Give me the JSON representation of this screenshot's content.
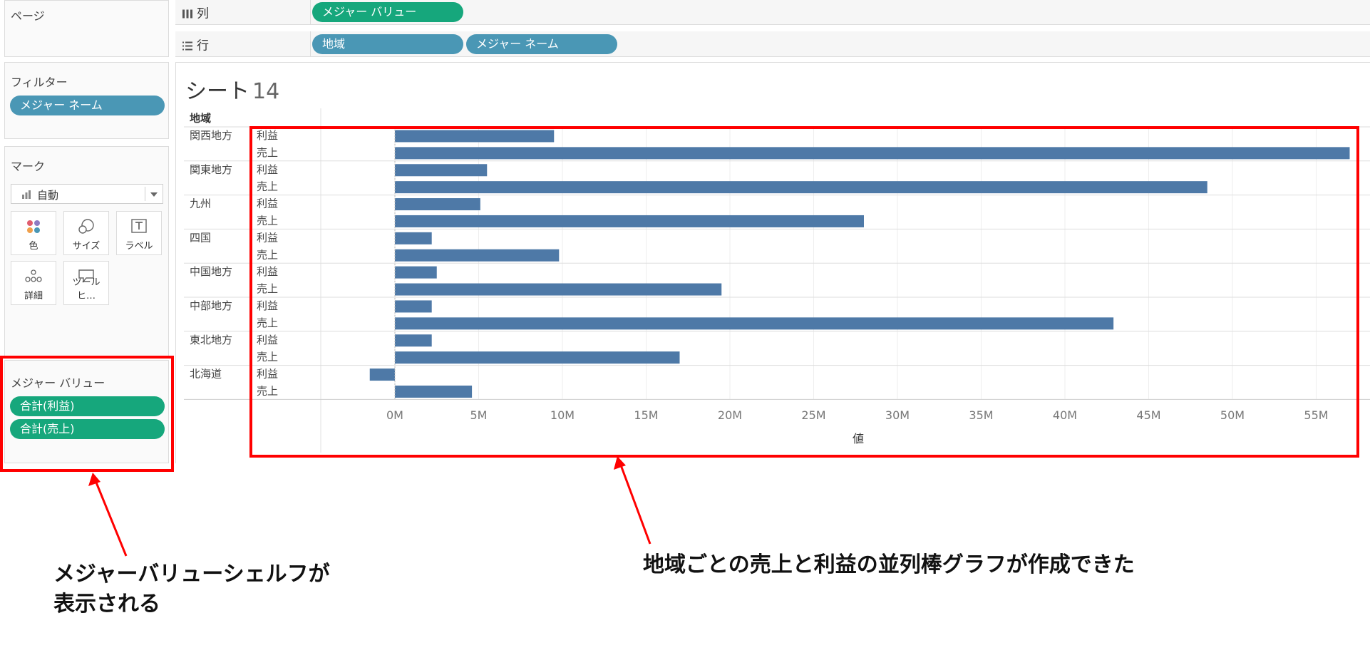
{
  "sidebar": {
    "pages_title": "ページ",
    "filters_title": "フィルター",
    "filter_pill": "メジャー ネーム",
    "marks_title": "マーク",
    "mark_type": "自動",
    "mark_buttons": [
      "色",
      "サイズ",
      "ラベル",
      "詳細",
      "ツールヒ…"
    ],
    "measure_values_title": "メジャー バリュー",
    "measure_pills": [
      "合計(利益)",
      "合計(売上)"
    ]
  },
  "shelves": {
    "columns_label": "列",
    "columns_pill": "メジャー バリュー",
    "rows_label": "行",
    "rows_pills": [
      "地域",
      "メジャー ネーム"
    ]
  },
  "sheet": {
    "title_prefix": "シート",
    "title_number": "14"
  },
  "chart_data": {
    "type": "bar",
    "orientation": "horizontal",
    "row_header": "地域",
    "xlabel": "値",
    "xlim": [
      -1.8,
      57.5
    ],
    "x_ticks": [
      0,
      5,
      10,
      15,
      20,
      25,
      30,
      35,
      40,
      45,
      50,
      55
    ],
    "x_tick_labels": [
      "0M",
      "5M",
      "10M",
      "15M",
      "20M",
      "25M",
      "30M",
      "35M",
      "40M",
      "45M",
      "50M",
      "55M"
    ],
    "measures": [
      "利益",
      "売上"
    ],
    "bar_color": "#4e79a7",
    "regions": [
      {
        "name": "関西地方",
        "profit": 9.5,
        "sales": 57.0
      },
      {
        "name": "関東地方",
        "profit": 5.5,
        "sales": 48.5
      },
      {
        "name": "九州",
        "profit": 5.1,
        "sales": 28.0
      },
      {
        "name": "四国",
        "profit": 2.2,
        "sales": 9.8
      },
      {
        "name": "中国地方",
        "profit": 2.5,
        "sales": 19.5
      },
      {
        "name": "中部地方",
        "profit": 2.2,
        "sales": 42.9
      },
      {
        "name": "東北地方",
        "profit": 2.2,
        "sales": 17.0
      },
      {
        "name": "北海道",
        "profit": -1.5,
        "sales": 4.6
      }
    ]
  },
  "annotations": {
    "left_line1": "メジャーバリューシェルフが",
    "left_line2": "表示される",
    "right": "地域ごとの売上と利益の並列棒グラフが作成できた"
  },
  "colors": {
    "highlight": "#ff0000",
    "pill_blue": "#4a97b5",
    "pill_green": "#16a77c"
  }
}
